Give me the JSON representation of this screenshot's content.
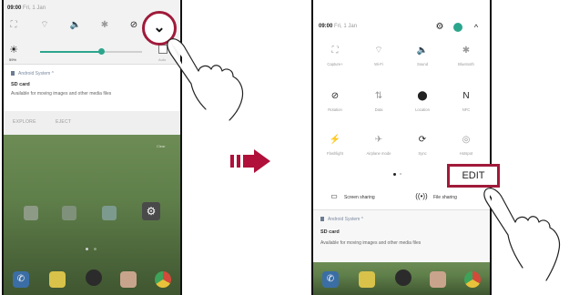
{
  "left_phone": {
    "time": "09:00",
    "date": "Fri, 1 Jan",
    "brightness_label": "59%",
    "brightness_fraction": 0.6,
    "auto_label": "Auto",
    "notification": {
      "app": "Android System ^",
      "title": "SD card",
      "text": "Available for moving images and other media files"
    },
    "actions": [
      "EXPLORE",
      "EJECT"
    ],
    "clear_label": "Clear"
  },
  "right_phone": {
    "time": "09:00",
    "date": "Fri, 1 Jan",
    "tiles": [
      {
        "icon": "screen-capture-icon",
        "glyph": "⛶",
        "label": "Capture+",
        "active": false
      },
      {
        "icon": "wifi-off-icon",
        "glyph": "⌔",
        "label": "Wi-Fi",
        "active": false
      },
      {
        "icon": "sound-icon",
        "glyph": "🔈",
        "label": "Sound",
        "active": true
      },
      {
        "icon": "bluetooth-off-icon",
        "glyph": "✱",
        "label": "Bluetooth",
        "active": false
      },
      {
        "icon": "rotation-icon",
        "glyph": "⊘",
        "label": "Rotation",
        "active": true
      },
      {
        "icon": "data-off-icon",
        "glyph": "⇅",
        "label": "Data",
        "active": false
      },
      {
        "icon": "location-icon",
        "glyph": "⬤",
        "label": "Location",
        "active": true
      },
      {
        "icon": "nfc-icon",
        "glyph": "N",
        "label": "NFC",
        "active": true
      },
      {
        "icon": "flashlight-off-icon",
        "glyph": "⚡",
        "label": "Flashlight",
        "active": false
      },
      {
        "icon": "airplane-mode-icon",
        "glyph": "✈",
        "label": "Airplane mode",
        "active": false
      },
      {
        "icon": "sync-icon",
        "glyph": "⟳",
        "label": "Sync",
        "active": true
      },
      {
        "icon": "hotspot-off-icon",
        "glyph": "◎",
        "label": "Hotspot",
        "active": false
      }
    ],
    "edit_label": "EDIT",
    "screen_sharing": "Screen sharing",
    "file_sharing": "File sharing",
    "notification": {
      "app": "Android System ^",
      "title": "SD card",
      "text": "Available for moving images and other media files"
    }
  },
  "colors": {
    "highlight": "#a01a3a",
    "arrow": "#b0103a",
    "account": "#2ca58d"
  }
}
